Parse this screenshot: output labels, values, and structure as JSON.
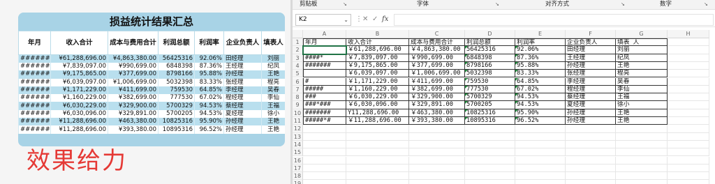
{
  "left": {
    "title": "损益统计结果汇总",
    "headers": [
      "年月",
      "收入合计",
      "成本与费用合计",
      "利润总额",
      "利润率",
      "企业负责人",
      "填表人"
    ],
    "rows": [
      [
        "#######",
        "¥61,288,696.00",
        "¥4,863,380.00",
        "56425316",
        "92.06%",
        "田经理",
        "刘丽"
      ],
      [
        "#######",
        "¥7,839,097.00",
        "¥990,699.00",
        "6848398",
        "87.36%",
        "王经理",
        "纪凤"
      ],
      [
        "#######",
        "¥9,175,865.00",
        "¥377,699.00",
        "8798166",
        "95.88%",
        "孙经理",
        "王艳"
      ],
      [
        "#######",
        "¥6,039,097.00",
        "¥1,006,699.00",
        "5032398",
        "83.33%",
        "张经理",
        "程亮"
      ],
      [
        "#######",
        "¥1,171,229.00",
        "¥411,699.00",
        "759530",
        "64.85%",
        "李经理",
        "吴春"
      ],
      [
        "#######",
        "¥1,160,229.00",
        "¥382,699.00",
        "777530",
        "67.02%",
        "程经理",
        "李仙"
      ],
      [
        "#######",
        "¥6,030,229.00",
        "¥329,900.00",
        "5700329",
        "94.53%",
        "蔡经理",
        "王福"
      ],
      [
        "#######",
        "¥6,030,096.00",
        "¥329,891.00",
        "5700205",
        "94.53%",
        "夏经理",
        "徐小"
      ],
      [
        "#######",
        "¥11,288,696.00",
        "¥463,380.00",
        "10825316",
        "95.90%",
        "孙经理",
        "王艳"
      ],
      [
        "#######",
        "¥11,288,696.00",
        "¥393,380.00",
        "10895316",
        "96.52%",
        "孙经理",
        "王艳"
      ]
    ]
  },
  "ribbon": {
    "groups": [
      "剪贴板",
      "字体",
      "对齐方式",
      "数字"
    ]
  },
  "formula_bar": {
    "name_box": "K2",
    "name_box_arrow": "⌄",
    "icons": [
      "⋮",
      "✕",
      "✓",
      "fx"
    ],
    "formula": ""
  },
  "grid": {
    "columns": [
      "A",
      "B",
      "C",
      "D",
      "E",
      "F",
      "G",
      "H"
    ],
    "row_numbers": [
      "1",
      "2",
      "3",
      "4",
      "5",
      "6",
      "7",
      "8",
      "9",
      "10",
      "11",
      "12",
      "13",
      "14",
      "15",
      "16",
      "17",
      "18",
      "19"
    ],
    "header": [
      "年月",
      "收入合计",
      "成本与费用合计",
      "利润总额",
      "利润率",
      "企业负责人",
      "填表 人"
    ],
    "rows": [
      [
        "",
        "￥61,288,696.00",
        "￥4,863,380.00",
        "56425316",
        "92.06%",
        "田经理",
        "刘丽"
      ],
      [
        "####*",
        "￥7,839,097.00",
        "￥990,699.00",
        "6848398",
        "87.36%",
        "王经理",
        "纪凤"
      ],
      [
        "#######",
        "￥9,175,865.00",
        "￥377,699.00",
        "8798166",
        "95.88%",
        "孙经理",
        "王艳"
      ],
      [
        "",
        "￥6,039,097.00",
        "￥1,006,699.00",
        "5032398",
        "83.33%",
        "张经理",
        "程亮"
      ],
      [
        "#",
        "￥1,171,229.00",
        "￥411,699.00",
        "759530",
        "64.85%",
        "李经理",
        "吴春"
      ],
      [
        "#####",
        "￥1,160,229.00",
        "￥382,699.00",
        "777530",
        "67.02%",
        "程经理",
        "李仙"
      ],
      [
        "###",
        "￥6,030,229.00",
        "￥329,900.00",
        "5700329",
        "94.53%",
        "蔡经理",
        "王福"
      ],
      [
        "###*###",
        "￥6,030,096.00",
        "￥329,891.00",
        "5700205",
        "94.53%",
        "夏经理",
        "徐小"
      ],
      [
        "#######",
        "Y11,288,696.00",
        "￥463,380.00",
        "10825316",
        "95.90%",
        "孙经理",
        "王艳"
      ],
      [
        "#####*#",
        "￥11,288,696.00",
        "￥393,380.00",
        "10895316",
        "96.52%",
        "孙经理",
        "王艳"
      ]
    ]
  },
  "overlay_text": "效果给力",
  "colors": {
    "left_bg": "#a8d3e6",
    "left_stripe": "#b9dfee",
    "overlay": "#e53935",
    "selection": "#217346",
    "error_triangle": "#1e8a3a"
  }
}
